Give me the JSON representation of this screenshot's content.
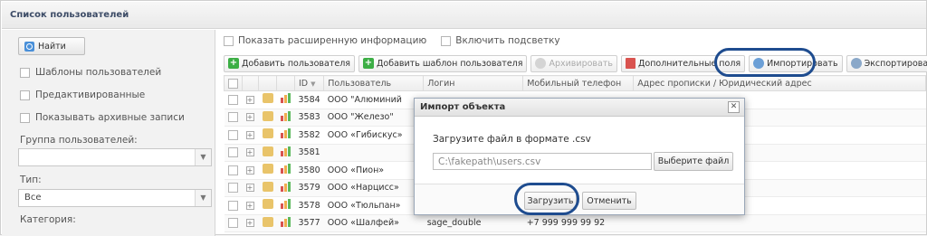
{
  "title": "Список пользователей",
  "sidebar": {
    "find_label": "Найти",
    "checks": [
      "Шаблоны пользователей",
      "Предактивированные",
      "Показывать архивные записи"
    ],
    "group_label": "Группа пользователей:",
    "group_value": "",
    "type_label": "Тип:",
    "type_value": "Все",
    "category_label": "Категория:"
  },
  "options": {
    "extended": "Показать расширенную информацию",
    "highlight": "Включить подсветку"
  },
  "toolbar": {
    "add_user": "Добавить пользователя",
    "add_template": "Добавить шаблон пользователя",
    "archive": "Архивировать",
    "extra_fields": "Дополнительные поля",
    "import": "Импортировать",
    "export": "Экспортировать"
  },
  "table": {
    "headers": [
      "ID",
      "Пользователь",
      "Логин",
      "Мобильный телефон",
      "Адрес прописки / Юридический адрес"
    ],
    "rows": [
      {
        "id": "3584",
        "user": "ООО \"Алюминий",
        "login": "",
        "phone": ""
      },
      {
        "id": "3583",
        "user": "ООО \"Железо\"",
        "login": "",
        "phone": ""
      },
      {
        "id": "3582",
        "user": "ООО «Гибискус»",
        "login": "",
        "phone": ""
      },
      {
        "id": "3581",
        "user": "",
        "login": "",
        "phone": ""
      },
      {
        "id": "3580",
        "user": "ООО «Пион»",
        "login": "",
        "phone": ""
      },
      {
        "id": "3579",
        "user": "ООО «Нарцисс»",
        "login": "",
        "phone": ""
      },
      {
        "id": "3578",
        "user": "ООО «Тюльпан»",
        "login": "",
        "phone": ""
      },
      {
        "id": "3577",
        "user": "ООО «Шалфей»",
        "login": "sage_double",
        "phone": "+7 999 999 99 92"
      }
    ]
  },
  "modal": {
    "title": "Импорт объекта",
    "text": "Загрузите файл в формате .csv",
    "file_value": "C:\\fakepath\\users.csv",
    "choose_file": "Выберите файл",
    "upload": "Загрузить",
    "cancel": "Отменить"
  },
  "colors": {
    "accent": "#1e4c8f",
    "add": "#3cae45"
  }
}
